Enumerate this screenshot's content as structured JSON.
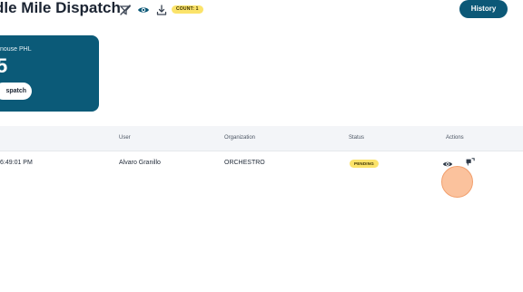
{
  "header": {
    "title": "dle Mile Dispatch",
    "count_badge": "COUNT: 1",
    "history_label": "History",
    "icons": [
      "filter-off-icon",
      "eye-icon",
      "download-icon"
    ]
  },
  "card": {
    "label": "nouse PHL",
    "count": "5",
    "button_label": "spatch"
  },
  "table": {
    "columns": [
      "User",
      "Organization",
      "Status",
      "Actions"
    ],
    "rows": [
      {
        "time": "6:49:01 PM",
        "user": "Alvaro Granillo",
        "organization": "ORCHESTRO",
        "status": "PENDING",
        "actions": [
          "eye-icon",
          "assign-icon"
        ]
      }
    ]
  },
  "colors": {
    "primary": "#0b5a78",
    "badge": "#fbe36a",
    "header_bg": "#f3f5f8",
    "cursor": "#fab78c"
  }
}
